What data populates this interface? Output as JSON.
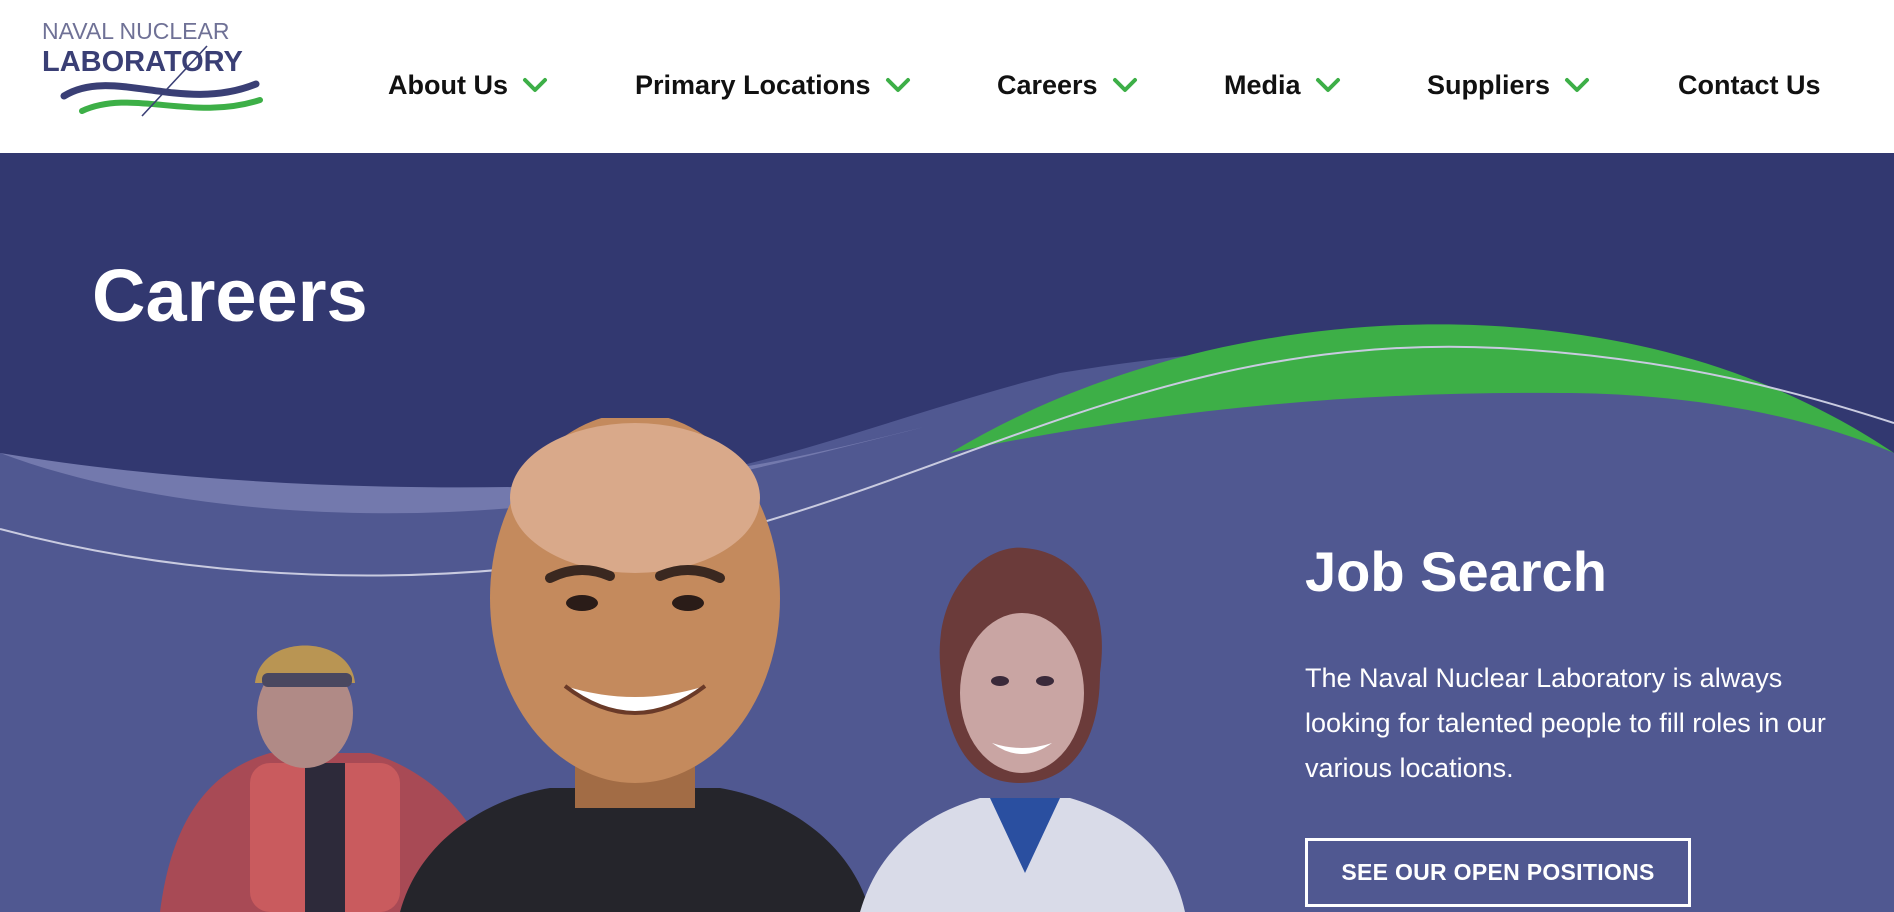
{
  "logo": {
    "line1": "NAVAL NUCLEAR",
    "line2": "LABORATORY"
  },
  "nav": {
    "items": [
      {
        "label": "About Us",
        "has_dropdown": true
      },
      {
        "label": "Primary Locations",
        "has_dropdown": true
      },
      {
        "label": "Careers",
        "has_dropdown": true
      },
      {
        "label": "Media",
        "has_dropdown": true
      },
      {
        "label": "Suppliers",
        "has_dropdown": true
      },
      {
        "label": "Contact Us",
        "has_dropdown": false
      }
    ],
    "chevron_icon": "chevron-down-icon"
  },
  "hero": {
    "title": "Careers",
    "job_search": {
      "heading": "Job Search",
      "body": "The Naval Nuclear Laboratory is always looking for talented people to fill roles in our various locations.",
      "cta_label": "SEE OUR OPEN POSITIONS"
    }
  },
  "colors": {
    "header_bg": "#ffffff",
    "hero_dark": "#323870",
    "hero_light": "#505891",
    "accent_green": "#3daf47",
    "nav_text": "#111111",
    "logo_navy": "#3a3f75"
  }
}
